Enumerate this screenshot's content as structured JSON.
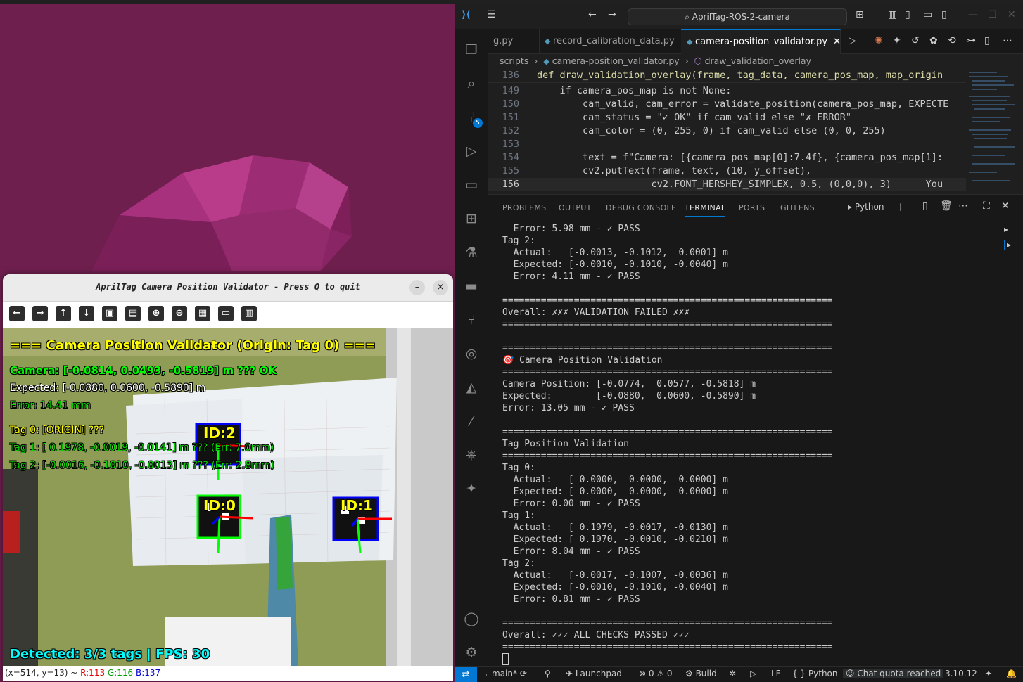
{
  "camera_window": {
    "title": "AprilTag Camera Position Validator - Press Q to quit",
    "minimize": "–",
    "close": "×",
    "toolbar_icons": [
      "arrow-left-icon",
      "arrow-right-icon",
      "arrow-up-icon",
      "arrow-down-icon",
      "image-icon",
      "save-image-icon",
      "zoom-in-icon",
      "zoom-out-icon",
      "save-icon",
      "clipboard-icon",
      "properties-icon"
    ],
    "overlay": {
      "heading": "=== Camera Position Validator (Origin: Tag 0) ===",
      "camera": "Camera: [-0.0814,  0.0493, -0.5819] m ??? OK",
      "expected": "Expected: [-0.0880,  0.0600, -0.5890] m",
      "error": "Error: 14.41 mm",
      "tag0": "Tag 0: [ORIGIN] ???",
      "tag1": "Tag 1: [ 0.1978, -0.0019, -0.0141] m ??? (Err: 7.0mm)",
      "tag2": "Tag 2: [-0.0016, -0.1010, -0.0013] m ??? (Err: 2.8mm)",
      "detected": "Detected: 3/3 tags | FPS: 30",
      "tag_labels": [
        "ID:2",
        "ID:0",
        "ID:1"
      ]
    },
    "status": {
      "coords": "(x=514, y=13) ~ ",
      "r": "R:113",
      "g": "G:116",
      "b": "B:137"
    }
  },
  "vscode": {
    "search": "AprilTag-ROS-2-camera",
    "tabs": [
      "g.py",
      "record_calibration_data.py",
      "camera-position_validator.py"
    ],
    "breadcrumb": [
      "scripts",
      "camera-position_validator.py",
      "draw_validation_overlay"
    ],
    "code": [
      {
        "n": "136",
        "t": "def draw_validation_overlay(frame, tag_data, camera_pos_map, map_origin"
      },
      {
        "n": "149",
        "t": "    if camera_pos_map is not None:"
      },
      {
        "n": "150",
        "t": "        cam_valid, cam_error = validate_position(camera_pos_map, EXPECTE"
      },
      {
        "n": "151",
        "t": "        cam_status = \"✓ OK\" if cam_valid else \"✗ ERROR\""
      },
      {
        "n": "152",
        "t": "        cam_color = (0, 255, 0) if cam_valid else (0, 0, 255)"
      },
      {
        "n": "153",
        "t": ""
      },
      {
        "n": "154",
        "t": "        text = f\"Camera: [{camera_pos_map[0]:7.4f}, {camera_pos_map[1]:"
      },
      {
        "n": "155",
        "t": "        cv2.putText(frame, text, (10, y_offset),"
      },
      {
        "n": "156",
        "t": "                    cv2.FONT_HERSHEY_SIMPLEX, 0.5, (0,0,0), 3)      You"
      }
    ],
    "panel_tabs": [
      "PROBLEMS",
      "OUTPUT",
      "DEBUG CONSOLE",
      "TERMINAL",
      "PORTS",
      "GITLENS"
    ],
    "panel_shell": "Python",
    "terminal": [
      "  Error: 5.98 mm - ✓ PASS",
      "Tag 2:",
      "  Actual:   [-0.0013, -0.1012,  0.0001] m",
      "  Expected: [-0.0010, -0.1010, -0.0040] m",
      "  Error: 4.11 mm - ✓ PASS",
      "",
      "============================================================",
      "Overall: ✗✗✗ VALIDATION FAILED ✗✗✗",
      "============================================================",
      "",
      "============================================================",
      "🎯 Camera Position Validation",
      "============================================================",
      "Camera Position: [-0.0774,  0.0577, -0.5818] m",
      "Expected:        [-0.0880,  0.0600, -0.5890] m",
      "Error: 13.05 mm - ✓ PASS",
      "",
      "============================================================",
      "Tag Position Validation",
      "============================================================",
      "Tag 0:",
      "  Actual:   [ 0.0000,  0.0000,  0.0000] m",
      "  Expected: [ 0.0000,  0.0000,  0.0000] m",
      "  Error: 0.00 mm - ✓ PASS",
      "Tag 1:",
      "  Actual:   [ 0.1979, -0.0017, -0.0130] m",
      "  Expected: [ 0.1970, -0.0010, -0.0210] m",
      "  Error: 8.04 mm - ✓ PASS",
      "Tag 2:",
      "  Actual:   [-0.0017, -0.1007, -0.0036] m",
      "  Expected: [-0.0010, -0.1010, -0.0040] m",
      "  Error: 0.81 mm - ✓ PASS",
      "",
      "============================================================",
      "Overall: ✓✓✓ ALL CHECKS PASSED ✓✓✓",
      "============================================================"
    ],
    "statusbar": {
      "branch": "main*",
      "launchpad": "Launchpad",
      "problems": "⊗ 0 ⚠ 0",
      "build": "Build",
      "eol": "LF",
      "lang": "Python",
      "chat": "Chat quota reached",
      "version": "3.10.12"
    }
  },
  "colors": {
    "accent": "#0078d4",
    "desktop": "#6f1f4e",
    "overlay_green": "#00ff00",
    "overlay_yellow": "#ffff00",
    "overlay_cyan": "#00ffff"
  }
}
